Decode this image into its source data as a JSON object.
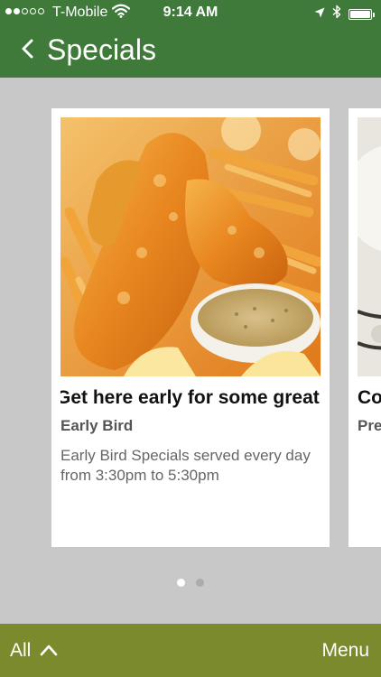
{
  "status_bar": {
    "carrier": "T-Mobile",
    "time": "9:14 AM",
    "signal_bars": 2,
    "signal_total": 5,
    "battery_level": 1.0
  },
  "header": {
    "title": "Specials",
    "back_icon": "chevron-left-icon"
  },
  "cards": [
    {
      "headline": "Get here early for some great",
      "subtitle": "Early Bird",
      "description": "Early Bird Specials served every day from 3:30pm to 5:30pm"
    },
    {
      "headline": "Co",
      "subtitle": "Pre",
      "description": ""
    }
  ],
  "pagination": {
    "total": 2,
    "active_index": 0
  },
  "bottom_bar": {
    "filter_label": "All",
    "filter_icon": "chevron-up-icon",
    "menu_label": "Menu"
  },
  "colors": {
    "header_bg": "#3f7a3b",
    "bottom_bar_bg": "#7c8a2e",
    "page_bg": "#c8c8c8",
    "card_bg": "#ffffff"
  }
}
